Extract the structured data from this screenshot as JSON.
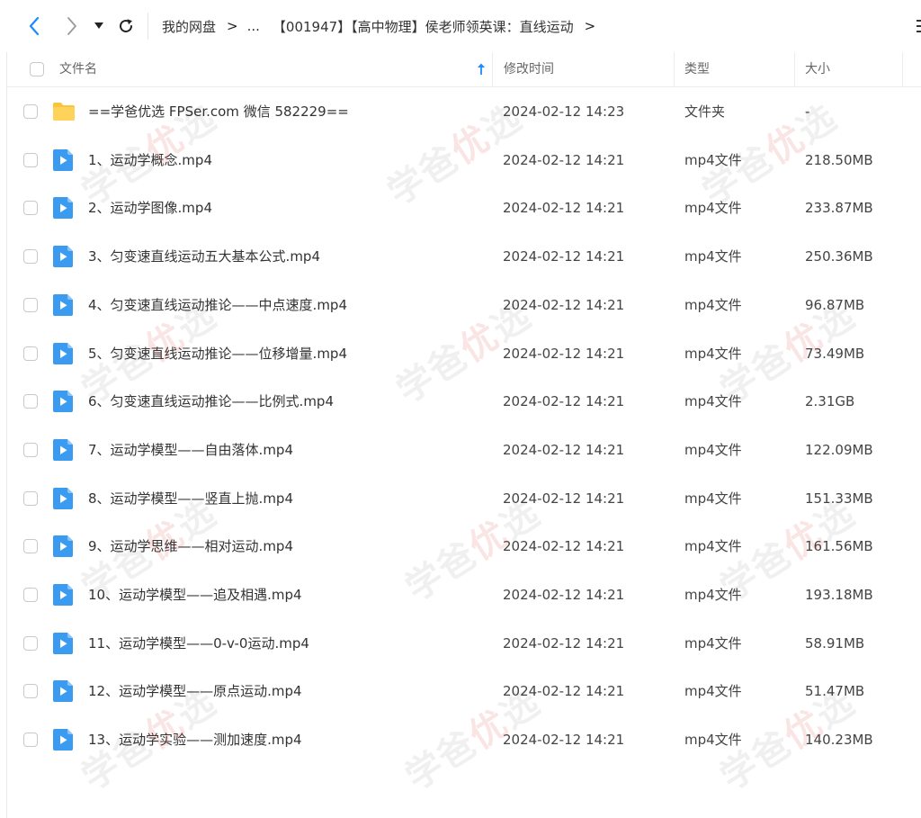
{
  "breadcrumb": {
    "root": "我的网盘",
    "ellipsis": "...",
    "current": "【001947】【高中物理】侯老师领英课：直线运动"
  },
  "columns": {
    "name": "文件名",
    "modified": "修改时间",
    "type": "类型",
    "size": "大小"
  },
  "files": [
    {
      "name": "==学爸优选 FPSer.com 微信 582229==",
      "modified": "2024-02-12 14:23",
      "type": "文件夹",
      "size": "-",
      "icon": "folder-icon"
    },
    {
      "name": "1、运动学概念.mp4",
      "modified": "2024-02-12 14:21",
      "type": "mp4文件",
      "size": "218.50MB",
      "icon": "video-file-icon"
    },
    {
      "name": "2、运动学图像.mp4",
      "modified": "2024-02-12 14:21",
      "type": "mp4文件",
      "size": "233.87MB",
      "icon": "video-file-icon"
    },
    {
      "name": "3、匀变速直线运动五大基本公式.mp4",
      "modified": "2024-02-12 14:21",
      "type": "mp4文件",
      "size": "250.36MB",
      "icon": "video-file-icon"
    },
    {
      "name": "4、匀变速直线运动推论——中点速度.mp4",
      "modified": "2024-02-12 14:21",
      "type": "mp4文件",
      "size": "96.87MB",
      "icon": "video-file-icon"
    },
    {
      "name": "5、匀变速直线运动推论——位移增量.mp4",
      "modified": "2024-02-12 14:21",
      "type": "mp4文件",
      "size": "73.49MB",
      "icon": "video-file-icon"
    },
    {
      "name": "6、匀变速直线运动推论——比例式.mp4",
      "modified": "2024-02-12 14:21",
      "type": "mp4文件",
      "size": "2.31GB",
      "icon": "video-file-icon"
    },
    {
      "name": "7、运动学模型——自由落体.mp4",
      "modified": "2024-02-12 14:21",
      "type": "mp4文件",
      "size": "122.09MB",
      "icon": "video-file-icon"
    },
    {
      "name": "8、运动学模型——竖直上抛.mp4",
      "modified": "2024-02-12 14:21",
      "type": "mp4文件",
      "size": "151.33MB",
      "icon": "video-file-icon"
    },
    {
      "name": "9、运动学思维——相对运动.mp4",
      "modified": "2024-02-12 14:21",
      "type": "mp4文件",
      "size": "161.56MB",
      "icon": "video-file-icon"
    },
    {
      "name": "10、运动学模型——追及相遇.mp4",
      "modified": "2024-02-12 14:21",
      "type": "mp4文件",
      "size": "193.18MB",
      "icon": "video-file-icon"
    },
    {
      "name": "11、运动学模型——0-v-0运动.mp4",
      "modified": "2024-02-12 14:21",
      "type": "mp4文件",
      "size": "58.91MB",
      "icon": "video-file-icon"
    },
    {
      "name": "12、运动学模型——原点运动.mp4",
      "modified": "2024-02-12 14:21",
      "type": "mp4文件",
      "size": "51.47MB",
      "icon": "video-file-icon"
    },
    {
      "name": "13、运动学实验——测加速度.mp4",
      "modified": "2024-02-12 14:21",
      "type": "mp4文件",
      "size": "140.23MB",
      "icon": "video-file-icon"
    }
  ],
  "watermark": {
    "part1": "学爸",
    "part2": "优",
    "part3": "选"
  },
  "colors": {
    "accent": "#1a8cff",
    "back_arrow": "#1a8cff",
    "folder": "#f8c53b",
    "video_icon": "#3b9bf0"
  }
}
